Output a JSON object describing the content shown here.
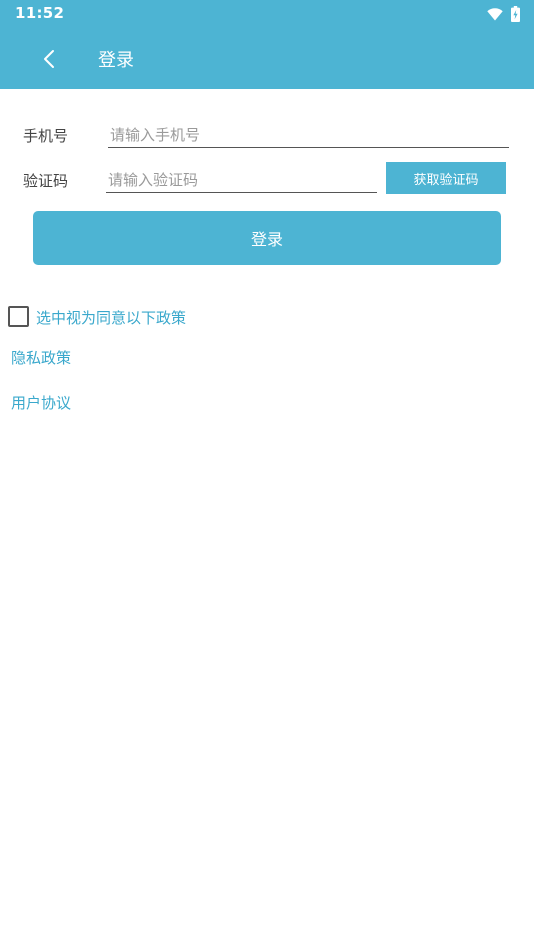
{
  "status_bar": {
    "time": "11:52",
    "icons": [
      "wifi-icon",
      "battery-charging-icon"
    ]
  },
  "toolbar": {
    "title": "登录",
    "back_icon": "chevron-left-icon"
  },
  "form": {
    "phone": {
      "label": "手机号",
      "value": "",
      "placeholder": "请输入手机号"
    },
    "code": {
      "label": "验证码",
      "value": "",
      "placeholder": "请输入验证码",
      "button_label": "获取验证码"
    },
    "login_button_label": "登录"
  },
  "agreement": {
    "checked": false,
    "text": "选中视为同意以下政策"
  },
  "links": {
    "privacy": "隐私政策",
    "user_agreement": "用户协议"
  },
  "colors": {
    "accent": "#4db4d3",
    "link": "#3aa8cc",
    "background": "#ffffff"
  }
}
